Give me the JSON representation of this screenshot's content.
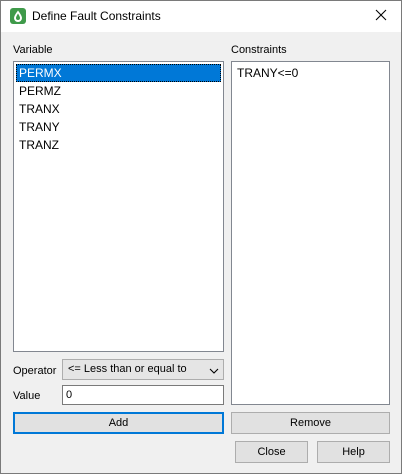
{
  "window": {
    "title": "Define Fault Constraints"
  },
  "variable": {
    "label": "Variable",
    "items": [
      "PERMX",
      "PERMZ",
      "TRANX",
      "TRANY",
      "TRANZ"
    ],
    "selected_index": 0
  },
  "constraints": {
    "label": "Constraints",
    "items": [
      "TRANY<=0"
    ]
  },
  "operator": {
    "label": "Operator",
    "value": "<= Less than or equal to"
  },
  "value_field": {
    "label": "Value",
    "value": "0"
  },
  "buttons": {
    "add": "Add",
    "remove": "Remove",
    "close": "Close",
    "help": "Help"
  },
  "colors": {
    "selection": "#0078d7",
    "app_icon": "#3f9a4a"
  },
  "icons": {
    "app": "drop-icon",
    "close": "close-icon",
    "dropdown": "chevron-down-icon"
  }
}
